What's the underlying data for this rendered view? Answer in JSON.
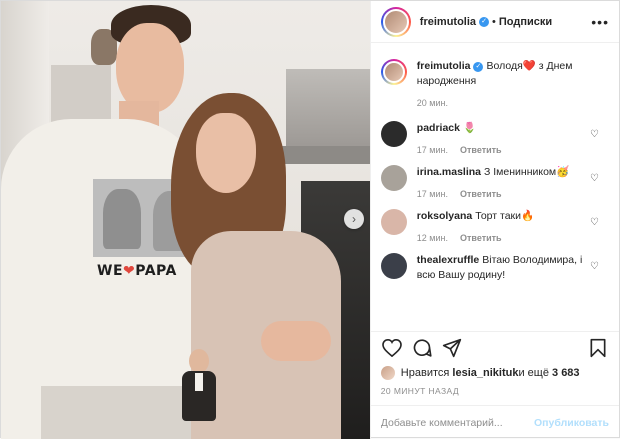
{
  "post": {
    "photo_text": "WE PAPA",
    "photo_text_a": "WE",
    "photo_text_heart": "❤",
    "photo_text_b": "PAPA",
    "next_icon": "›"
  },
  "header": {
    "username": "freimutolia",
    "separator": "•",
    "follow_label": "Подписки",
    "more_icon": "•••"
  },
  "caption": {
    "username": "freimutolia",
    "text_a": "Володя",
    "heart": "❤️",
    "text_b": " з Днем народження",
    "time": "20 мин."
  },
  "comments": [
    {
      "username": "padriack",
      "text": "🌷",
      "time": "17 мин.",
      "reply": "Ответить",
      "avatar_color": "#2b2b2b"
    },
    {
      "username": "irina.maslina",
      "text": "З Іменинником🥳",
      "time": "17 мин.",
      "reply": "Ответить",
      "avatar_color": "#a8a29a"
    },
    {
      "username": "roksolyana",
      "text": "Торт таки🔥",
      "time": "12 мин.",
      "reply": "Ответить",
      "avatar_color": "#d9b6a8"
    },
    {
      "username": "thealexruffle",
      "text": "Вітаю Володимира, і всю Вашу родину!",
      "time": "",
      "reply": "",
      "avatar_color": "#3b3f49"
    }
  ],
  "actions": {
    "likes_prefix": "Нравится ",
    "likes_user": "lesia_nikituk",
    "likes_mid": " и ещё ",
    "likes_count": "3 683",
    "time_ago": "20 МИНУТ НАЗАД"
  },
  "comment_box": {
    "placeholder": "Добавьте комментарий...",
    "publish_label": "Опубликовать"
  },
  "colors": {
    "verified": "#3897f0",
    "heart_red": "#ed4956",
    "publish_disabled": "#b2dffc",
    "meta_gray": "#8e8e8e"
  },
  "icons": [
    "heart-icon",
    "comment-icon",
    "share-icon",
    "bookmark-icon",
    "verified-icon",
    "more-icon",
    "chevron-right-icon",
    "like-heart-icon"
  ]
}
